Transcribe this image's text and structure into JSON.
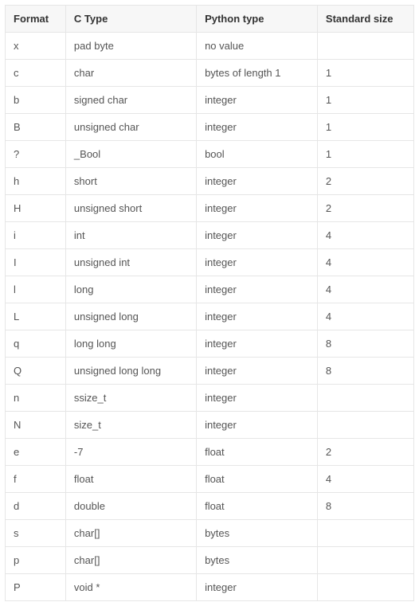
{
  "table": {
    "headers": {
      "format": "Format",
      "ctype": "C Type",
      "ptype": "Python type",
      "size": "Standard size"
    },
    "rows": [
      {
        "format": "x",
        "ctype": "pad byte",
        "ptype": "no value",
        "size": ""
      },
      {
        "format": "c",
        "ctype": "char",
        "ptype": "bytes of length 1",
        "size": "1"
      },
      {
        "format": "b",
        "ctype": "signed char",
        "ptype": "integer",
        "size": "1"
      },
      {
        "format": "B",
        "ctype": "unsigned char",
        "ptype": "integer",
        "size": "1"
      },
      {
        "format": "?",
        "ctype": "_Bool",
        "ptype": "bool",
        "size": "1"
      },
      {
        "format": "h",
        "ctype": "short",
        "ptype": "integer",
        "size": "2"
      },
      {
        "format": "H",
        "ctype": "unsigned short",
        "ptype": "integer",
        "size": "2"
      },
      {
        "format": "i",
        "ctype": "int",
        "ptype": "integer",
        "size": "4"
      },
      {
        "format": "I",
        "ctype": "unsigned int",
        "ptype": "integer",
        "size": "4"
      },
      {
        "format": "l",
        "ctype": "long",
        "ptype": "integer",
        "size": "4"
      },
      {
        "format": "L",
        "ctype": "unsigned long",
        "ptype": "integer",
        "size": "4"
      },
      {
        "format": "q",
        "ctype": "long long",
        "ptype": "integer",
        "size": "8"
      },
      {
        "format": "Q",
        "ctype": "unsigned long long",
        "ptype": "integer",
        "size": "8"
      },
      {
        "format": "n",
        "ctype": "ssize_t",
        "ptype": "integer",
        "size": ""
      },
      {
        "format": "N",
        "ctype": "size_t",
        "ptype": "integer",
        "size": ""
      },
      {
        "format": "e",
        "ctype": "-7",
        "ptype": "float",
        "size": "2"
      },
      {
        "format": "f",
        "ctype": "float",
        "ptype": "float",
        "size": "4"
      },
      {
        "format": "d",
        "ctype": "double",
        "ptype": "float",
        "size": "8"
      },
      {
        "format": "s",
        "ctype": "char[]",
        "ptype": "bytes",
        "size": ""
      },
      {
        "format": "p",
        "ctype": "char[]",
        "ptype": "bytes",
        "size": ""
      },
      {
        "format": "P",
        "ctype": "void *",
        "ptype": "integer",
        "size": ""
      }
    ]
  }
}
